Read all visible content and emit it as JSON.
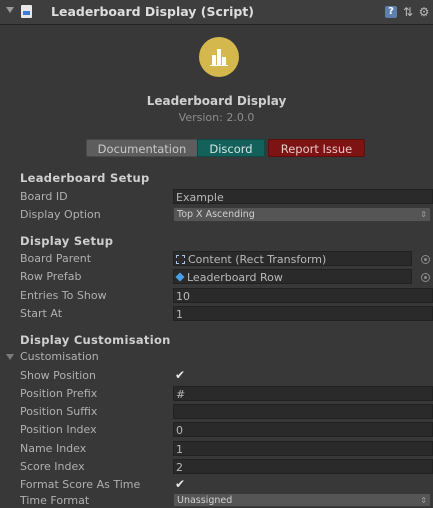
{
  "header": {
    "title": "Leaderboard Display (Script)",
    "icons": [
      "script-icon",
      "help-icon",
      "preset-icon",
      "gear-icon"
    ]
  },
  "product": {
    "name": "Leaderboard Display",
    "version": "Version: 2.0.0"
  },
  "buttons": {
    "documentation": "Documentation",
    "discord": "Discord",
    "report": "Report Issue"
  },
  "colors": {
    "discord": "#14605b",
    "report": "#7d1313",
    "logo": "#d5b84d"
  },
  "setup": {
    "title": "Leaderboard Setup",
    "board_id_label": "Board ID",
    "board_id_value": "Example",
    "display_option_label": "Display Option",
    "display_option_value": "Top X Ascending"
  },
  "display": {
    "title": "Display Setup",
    "board_parent_label": "Board Parent",
    "board_parent_value": "Content (Rect Transform)",
    "row_prefab_label": "Row Prefab",
    "row_prefab_value": "Leaderboard Row",
    "entries_label": "Entries To Show",
    "entries_value": "10",
    "start_label": "Start At",
    "start_value": "1"
  },
  "custom": {
    "title": "Display Customisation",
    "group_label": "Customisation",
    "show_position_label": "Show Position",
    "show_position_value": true,
    "position_prefix_label": "Position Prefix",
    "position_prefix_value": "#",
    "position_suffix_label": "Position Suffix",
    "position_suffix_value": "",
    "position_index_label": "Position Index",
    "position_index_value": "0",
    "name_index_label": "Name Index",
    "name_index_value": "1",
    "score_index_label": "Score Index",
    "score_index_value": "2",
    "format_time_label": "Format Score As Time",
    "format_time_value": true,
    "time_format_label": "Time Format",
    "time_format_value": "Unassigned"
  }
}
